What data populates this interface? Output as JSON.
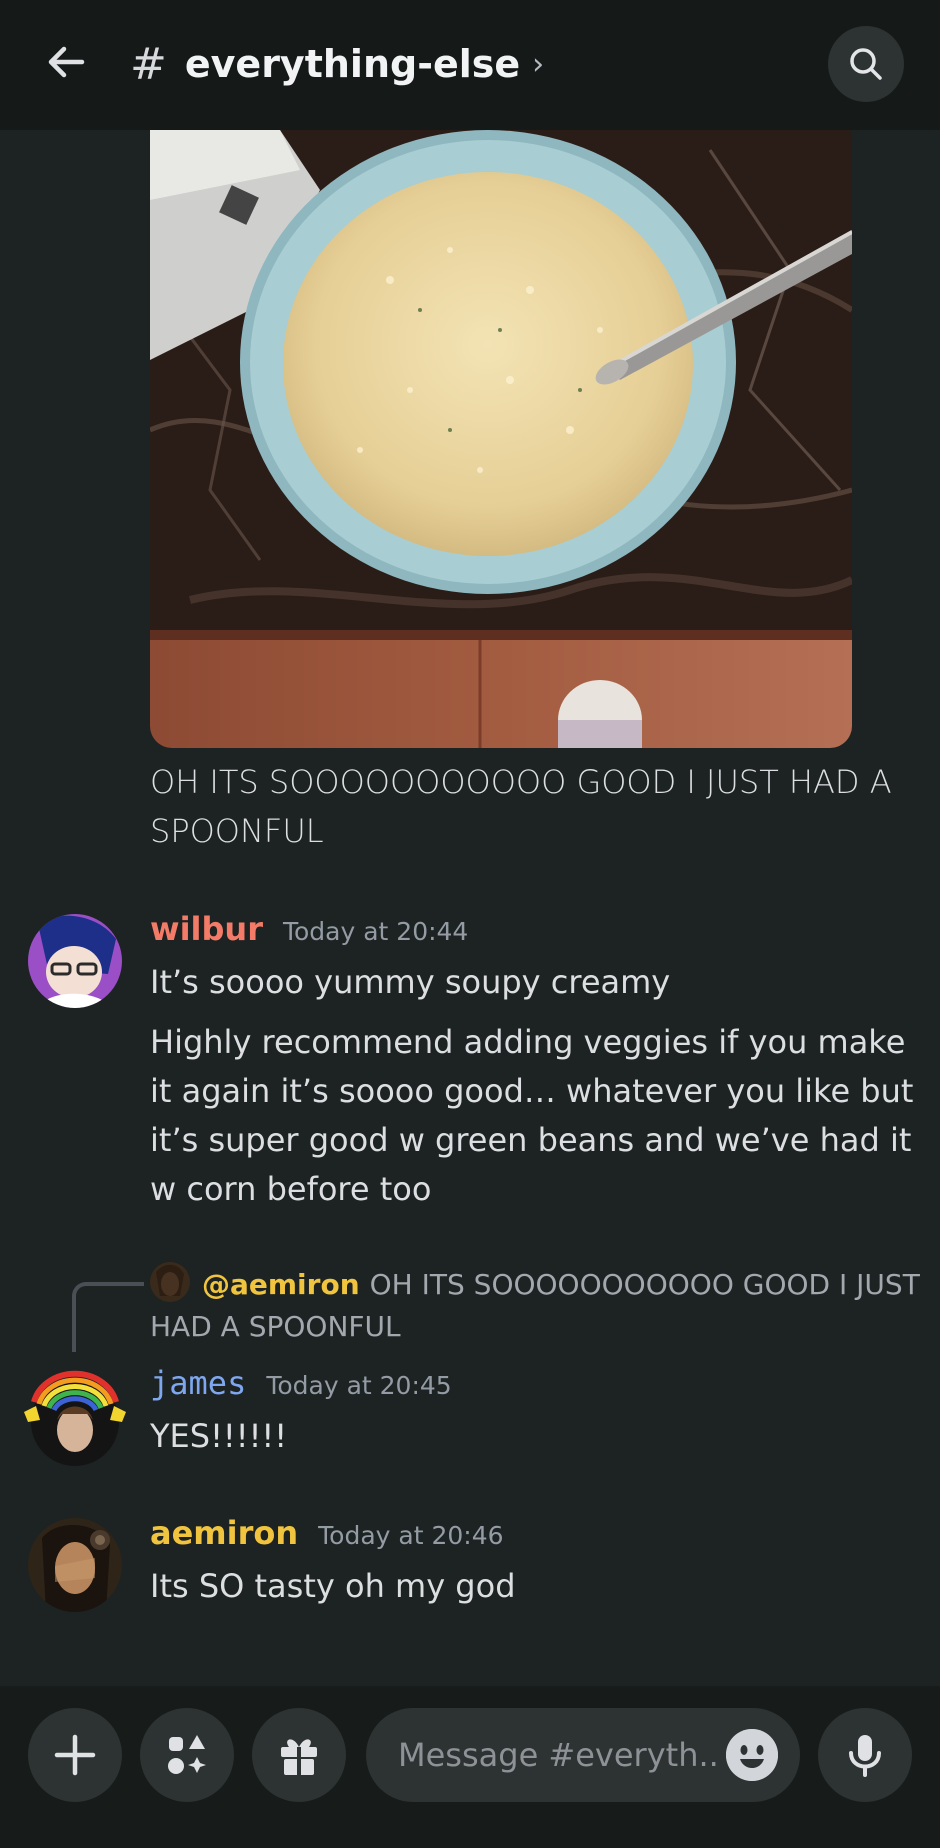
{
  "header": {
    "channel_name": "everything-else",
    "hash_symbol": "#",
    "chevron": "›"
  },
  "attachment": {
    "caption": "OH ITS SOOOOOOOOOOO GOOD I JUST HAD A SPOONFUL"
  },
  "messages": [
    {
      "author": "wilbur",
      "author_color": "#f47b67",
      "timestamp": "Today at 20:44",
      "lines": [
        "It’s soooo yummy soupy creamy",
        "Highly recommend adding veggies if you make it again it’s soooo good… whatever you like but it’s super good w green beans and we’ve had it w corn before too"
      ]
    },
    {
      "reply": {
        "mention": "@aemiron",
        "text": "OH ITS SOOOOOOOOOOO GOOD I JUST HAD A SPOONFUL"
      },
      "author": "james",
      "author_color": "#7fa7ef",
      "timestamp": "Today at 20:45",
      "lines": [
        "YES!!!!!!"
      ]
    },
    {
      "author": "aemiron",
      "author_color": "#f0c43f",
      "timestamp": "Today at 20:46",
      "lines": [
        "Its SO tasty oh my god"
      ]
    }
  ],
  "composer": {
    "placeholder": "Message #everyth.."
  },
  "icons": {
    "back": "arrow-left-icon",
    "search": "search-icon",
    "add": "plus-icon",
    "apps": "apps-icon",
    "gift": "gift-icon",
    "emoji": "smiley-icon",
    "mic": "microphone-icon"
  }
}
